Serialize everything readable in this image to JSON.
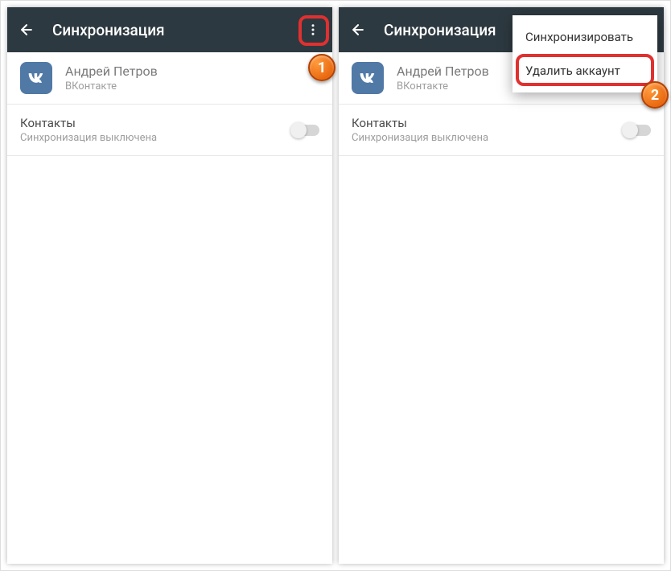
{
  "left": {
    "title": "Синхронизация",
    "account_name": "Андрей Петров",
    "account_service": "ВКонтакте",
    "vk_label": "w",
    "setting_title": "Контакты",
    "setting_sub": "Синхронизация выключена"
  },
  "right": {
    "title": "Синхронизация",
    "account_name": "Андрей Петров",
    "account_service": "ВКонтакте",
    "vk_label": "w",
    "setting_title": "Контакты",
    "setting_sub": "Синхронизация выключена",
    "menu": {
      "sync": "Синхронизировать",
      "delete": "Удалить аккаунт"
    }
  },
  "markers": {
    "m1": "1",
    "m2": "2"
  }
}
